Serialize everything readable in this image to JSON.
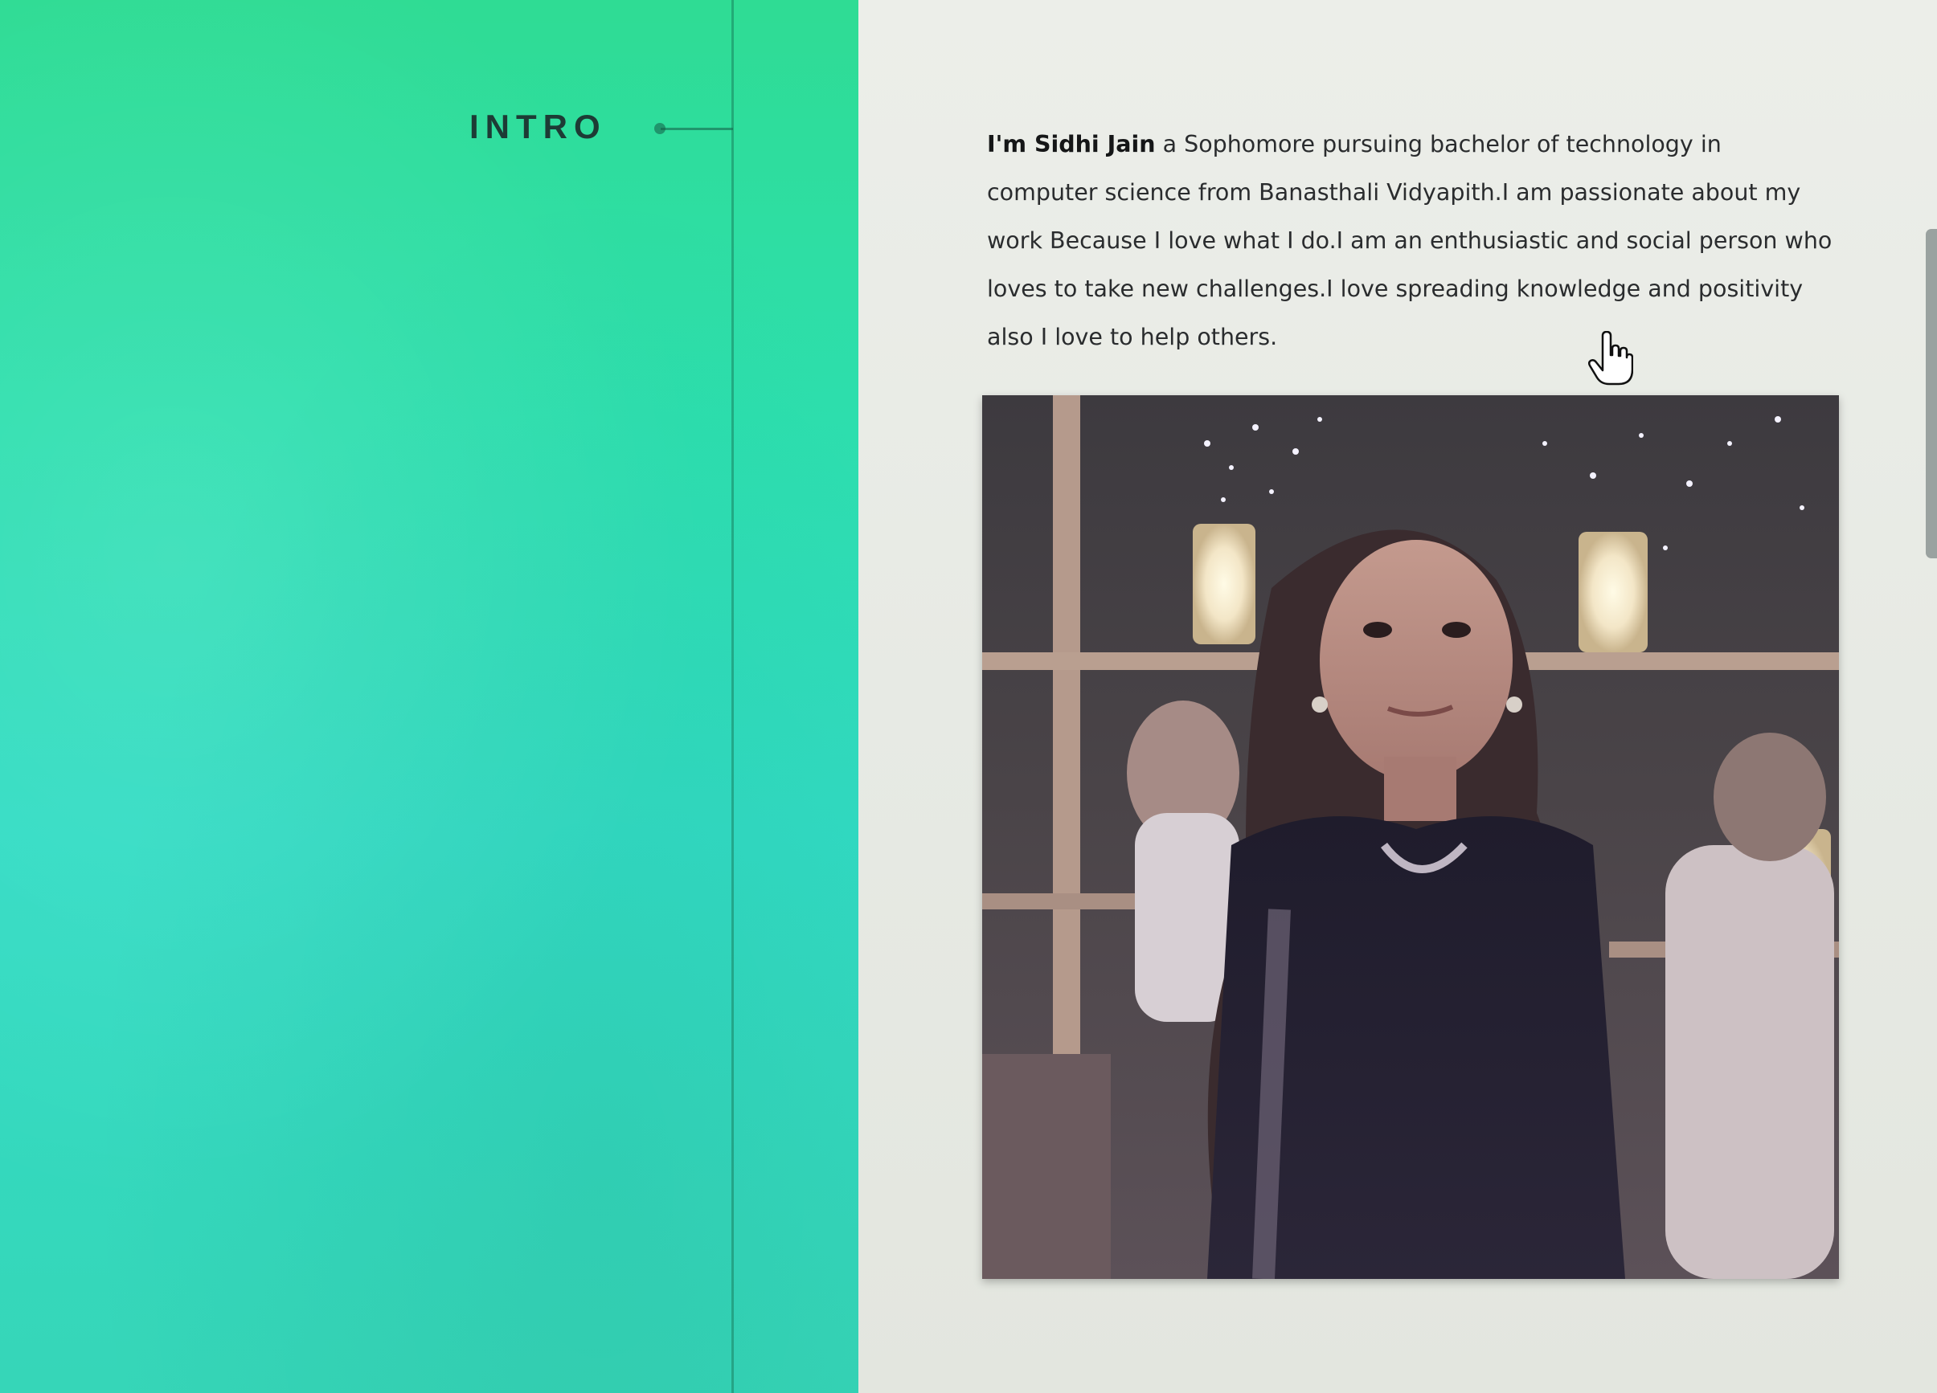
{
  "section": {
    "title": "INTRO"
  },
  "intro": {
    "name": "I'm Sidhi Jain",
    "text": " a Sophomore pursuing bachelor of technology in computer science from Banasthali Vidyapith.I am passionate about my work Because I love what I do.I am an enthusiastic and social person who loves to take new challenges.I love spreading knowledge and positivity also I love to help others."
  },
  "icons": {
    "cursor": "hand-pointer-icon"
  },
  "colors": {
    "panel_green": "#2fdc94",
    "panel_teal": "#32dcc4",
    "title_text": "#1d3b35",
    "body_text": "#2a2c2e"
  }
}
